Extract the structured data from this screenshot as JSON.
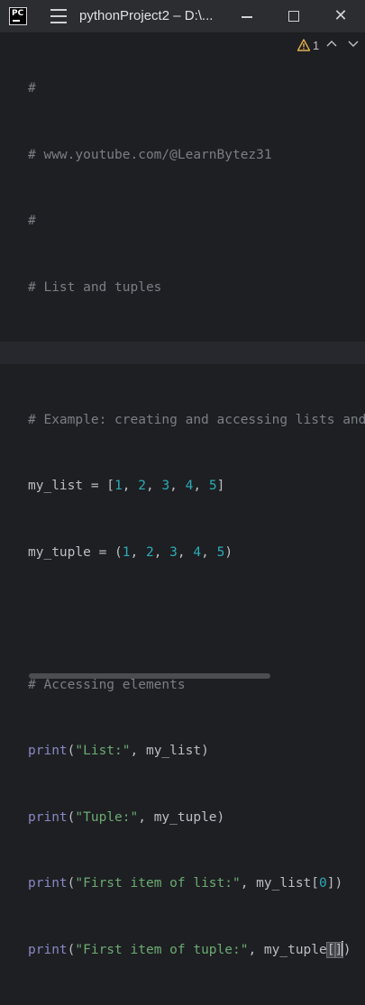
{
  "titlebar": {
    "logo_text": "PC",
    "title": "pythonProject2 – D:\\...",
    "minimize": "minimize",
    "maximize": "maximize",
    "close_glyph": "✕"
  },
  "inspection": {
    "warning_count": "1"
  },
  "code": {
    "lines": [
      "#",
      "# www.youtube.com/@LearnBytez31",
      "#",
      "# List and tuples",
      "",
      "# Example: creating and accessing lists and",
      "my_list = [1, 2, 3, 4, 5]",
      "my_tuple = (1, 2, 3, 4, 5)",
      "",
      "# Accessing elements",
      "print(\"List:\", my_list)",
      "print(\"Tuple:\", my_tuple)",
      "print(\"First item of list:\", my_list[0])",
      "print(\"First item of tuple:\", my_tuple[])"
    ]
  },
  "colors": {
    "background": "#1e1f22",
    "comment": "#7a7e85",
    "number": "#2aacb8",
    "string": "#6aab73",
    "builtin": "#8888c6",
    "text": "#bcbec4"
  },
  "icons": [
    "pycharm-logo-icon",
    "hamburger-menu-icon",
    "warning-icon",
    "chevron-up-icon",
    "chevron-down-icon",
    "close-icon"
  ]
}
